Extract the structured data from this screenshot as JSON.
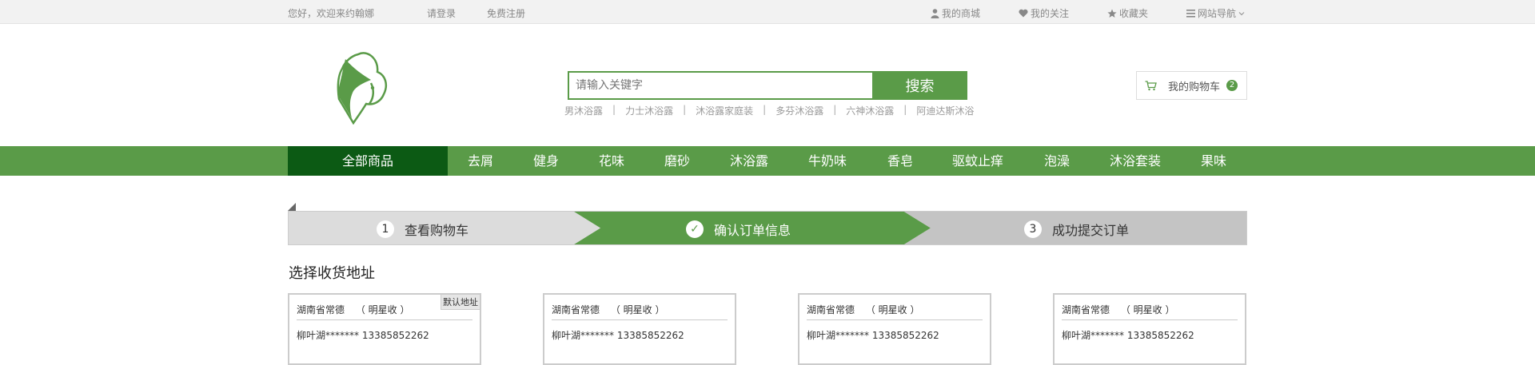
{
  "topbar": {
    "greeting": "您好，欢迎来约翰娜",
    "login": "请登录",
    "register": "免费注册",
    "links": [
      {
        "label": "我的商城",
        "icon": "user-icon"
      },
      {
        "label": "我的关注",
        "icon": "heart-icon"
      },
      {
        "label": "收藏夹",
        "icon": "star-icon"
      },
      {
        "label": "网站导航",
        "icon": "list-icon"
      }
    ]
  },
  "search": {
    "placeholder": "请输入关键字",
    "button": "搜索",
    "hot_keywords": [
      "男沐浴露",
      "力士沐浴露",
      "沐浴露家庭装",
      "多芬沐浴露",
      "六神沐浴露",
      "阿迪达斯沐浴"
    ]
  },
  "cart": {
    "label": "我的购物车",
    "count": "2"
  },
  "nav": {
    "all": "全部商品",
    "items": [
      "去屑",
      "健身",
      "花味",
      "磨砂",
      "沐浴露",
      "牛奶味",
      "香皂",
      "驱蚊止痒",
      "泡澡",
      "沐浴套装",
      "果味"
    ]
  },
  "steps": [
    {
      "num": "1",
      "label": "查看购物车"
    },
    {
      "num": "✓",
      "label": "确认订单信息"
    },
    {
      "num": "3",
      "label": "成功提交订单"
    }
  ],
  "address_section": {
    "title": "选择收货地址",
    "default_label": "默认地址",
    "cards": [
      {
        "region": "湖南省常德",
        "name": "（ 明星收 ）",
        "detail": "柳叶湖******* 13385852262"
      },
      {
        "region": "湖南省常德",
        "name": "（ 明星收 ）",
        "detail": "柳叶湖******* 13385852262"
      },
      {
        "region": "湖南省常德",
        "name": "（ 明星收 ）",
        "detail": "柳叶湖******* 13385852262"
      },
      {
        "region": "湖南省常德",
        "name": "（ 明星收 ）",
        "detail": "柳叶湖******* 13385852262"
      }
    ]
  },
  "colors": {
    "brand_green": "#5a9b48",
    "dark_green": "#0c5a14"
  }
}
